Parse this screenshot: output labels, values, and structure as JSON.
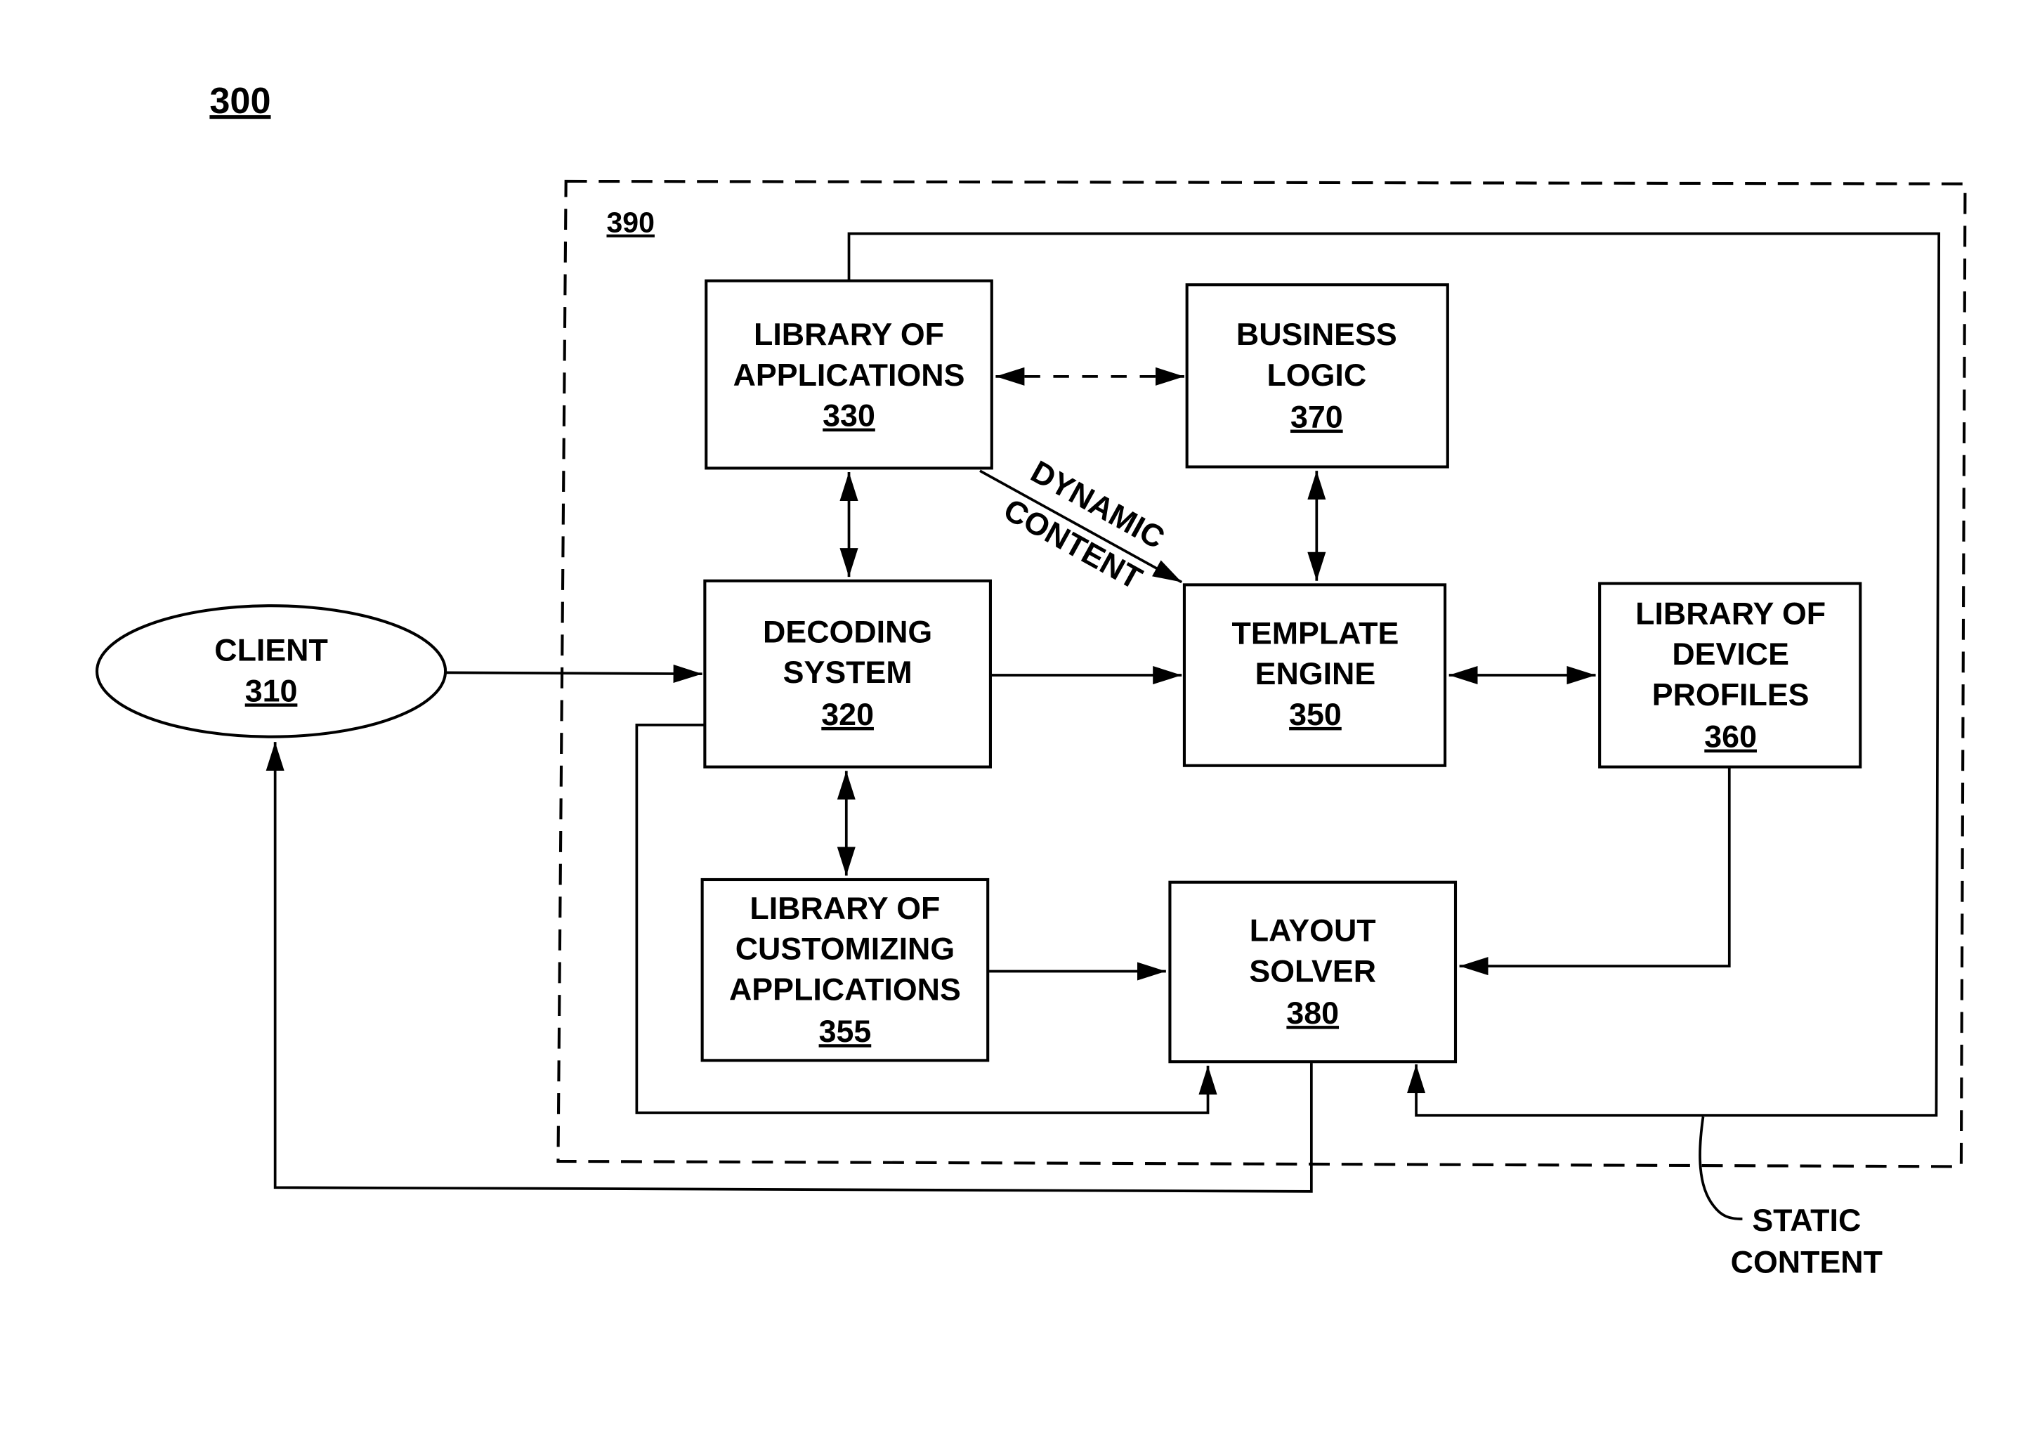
{
  "figure": {
    "number": "300",
    "container_ref": "390"
  },
  "nodes": {
    "client": {
      "lines": [
        "CLIENT"
      ],
      "ref": "310"
    },
    "decoding": {
      "lines": [
        "DECODING",
        "SYSTEM"
      ],
      "ref": "320"
    },
    "library_apps": {
      "lines": [
        "LIBRARY OF",
        "APPLICATIONS"
      ],
      "ref": "330"
    },
    "template": {
      "lines": [
        "TEMPLATE",
        "ENGINE"
      ],
      "ref": "350"
    },
    "library_custom": {
      "lines": [
        "LIBRARY OF",
        "CUSTOMIZING",
        "APPLICATIONS"
      ],
      "ref": "355"
    },
    "device_profiles": {
      "lines": [
        "LIBRARY OF",
        "DEVICE",
        "PROFILES"
      ],
      "ref": "360"
    },
    "business": {
      "lines": [
        "BUSINESS",
        "LOGIC"
      ],
      "ref": "370"
    },
    "layout": {
      "lines": [
        "LAYOUT",
        "SOLVER"
      ],
      "ref": "380"
    }
  },
  "annotations": {
    "dynamic_line1": "DYNAMIC",
    "dynamic_line2": "CONTENT",
    "static_line1": "STATIC",
    "static_line2": "CONTENT"
  }
}
